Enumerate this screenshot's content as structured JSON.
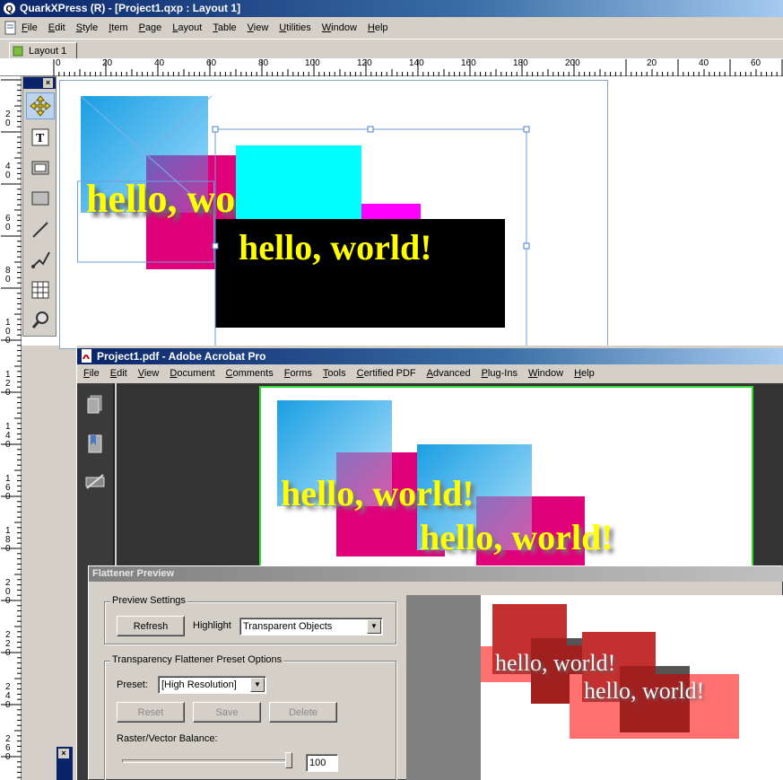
{
  "quark": {
    "title": "QuarkXPress (R) - [Project1.qxp : Layout 1]",
    "menu": [
      "File",
      "Edit",
      "Style",
      "Item",
      "Page",
      "Layout",
      "Table",
      "View",
      "Utilities",
      "Window",
      "Help"
    ],
    "layout_tab": "Layout 1",
    "ruler_h_labels": [
      "0",
      "20",
      "40",
      "60",
      "80",
      "100",
      "120",
      "140",
      "160",
      "180",
      "200",
      "20",
      "40",
      "60"
    ],
    "ruler_v_labels": [
      "2 0",
      "4 0",
      "6 0",
      "8 0",
      "1 0 0",
      "1 2 0",
      "1 4 0",
      "1 6 0",
      "1 8 0",
      "2 0 0",
      "2 2 0",
      "2 4 0",
      "2 6 0"
    ],
    "tools": [
      "move-tool",
      "text-tool",
      "picture-box-tool",
      "rectangle-tool",
      "line-tool",
      "bezier-pen-tool",
      "table-tool",
      "zoom-tool"
    ],
    "text1": "hello, world!",
    "text2": "hello, world!"
  },
  "acrobat": {
    "title": "Project1.pdf - Adobe Acrobat Pro",
    "menu": [
      "File",
      "Edit",
      "View",
      "Document",
      "Comments",
      "Forms",
      "Tools",
      "Certified PDF",
      "Advanced",
      "Plug-Ins",
      "Window",
      "Help"
    ],
    "text1": "hello, world!",
    "text2": "hello, world!"
  },
  "flattener": {
    "title": "Flattener Preview",
    "preview_settings_label": "Preview Settings",
    "refresh_label": "Refresh",
    "highlight_label": "Highlight",
    "highlight_value": "Transparent Objects",
    "preset_options_label": "Transparency Flattener Preset Options",
    "preset_label": "Preset:",
    "preset_value": "[High Resolution]",
    "reset_label": "Reset",
    "save_label": "Save",
    "delete_label": "Delete",
    "raster_vector_label": "Raster/Vector Balance:",
    "raster_vector_value": "100",
    "raster_vector_slider_fraction": 1.0,
    "preview_text1": "hello, world!",
    "preview_text2": "hello, world!"
  },
  "colors": {
    "highlight_red": "#c62828",
    "cyan": "#00ffff",
    "magenta": "#e0007a",
    "yellow": "#ffff00"
  }
}
